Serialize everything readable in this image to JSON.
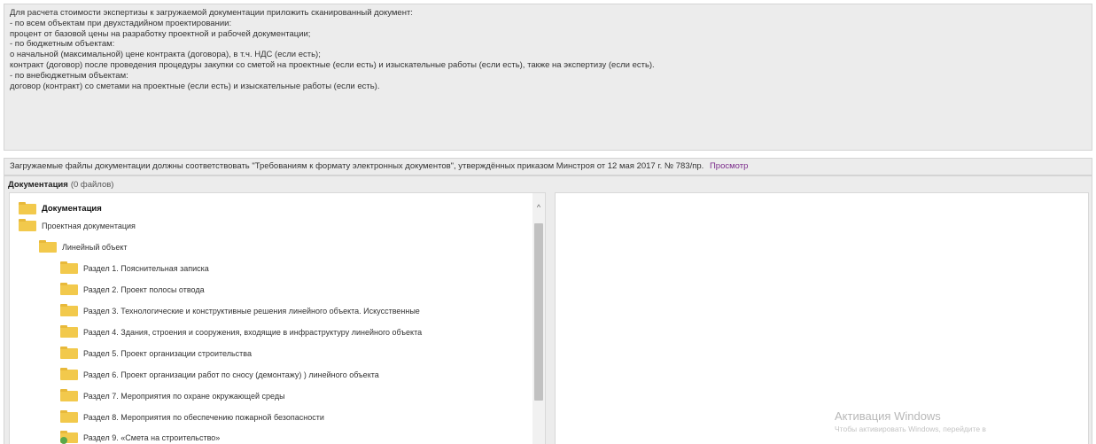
{
  "info": {
    "lines": [
      "Для расчета стоимости экспертизы к загружаемой документации приложить сканированный документ:",
      "- по всем объектам при двухстадийном проектировании:",
      "  процент от базовой цены на разработку проектной и рабочей документации;",
      "- по бюджетным объектам:",
      "  о начальной (максимальной) цене контракта (договора), в т.ч. НДС (если есть);",
      "  контракт (договор) после проведения процедуры закупки со сметой на проектные (если есть) и изыскательные работы (если есть), также на экспертизу (если есть).",
      "- по внебюджетным объектам:",
      "  договор (контракт) со сметами на проектные (если есть) и изыскательные работы (если есть)."
    ]
  },
  "format_notice": {
    "text": "Загружаемые файлы документации должны соответствовать \"Требованиям к формату электронных документов\", утверждённых приказом Минстроя от 12 мая 2017 г. № 783/пр.",
    "link": "Просмотр"
  },
  "documents": {
    "title": "Документация",
    "count": "(0 файлов)",
    "tree": [
      {
        "label": "Документация",
        "level": 0,
        "root": true,
        "badge": false
      },
      {
        "label": "Проектная документация",
        "level": 1,
        "root": false,
        "badge": false
      },
      {
        "label": "Линейный объект",
        "level": 2,
        "root": false,
        "badge": false
      },
      {
        "label": "Раздел 1. Пояснительная записка",
        "level": 3,
        "root": false,
        "badge": false
      },
      {
        "label": "Раздел 2. Проект полосы отвода",
        "level": 3,
        "root": false,
        "badge": false
      },
      {
        "label": "Раздел 3. Технологические и конструктивные решения линейного объекта. Искусственные",
        "level": 3,
        "root": false,
        "badge": false
      },
      {
        "label": "Раздел 4. Здания, строения и сооружения, входящие в инфраструктуру линейного объекта",
        "level": 3,
        "root": false,
        "badge": false
      },
      {
        "label": "Раздел 5. Проект организации строительства",
        "level": 3,
        "root": false,
        "badge": false
      },
      {
        "label": "Раздел 6. Проект организации работ по сносу (демонтажу) ) линейного объекта",
        "level": 3,
        "root": false,
        "badge": false
      },
      {
        "label": "Раздел 7. Мероприятия по охране окружающей среды",
        "level": 3,
        "root": false,
        "badge": false
      },
      {
        "label": "Раздел 8. Мероприятия по обеспечению пожарной безопасности",
        "level": 3,
        "root": false,
        "badge": false
      },
      {
        "label": "Раздел 9. «Смета на строительство»",
        "level": 3,
        "root": false,
        "badge": true
      }
    ]
  },
  "watermark": {
    "title": "Активация Windows",
    "subtitle": "Чтобы активировать Windows, перейдите в"
  },
  "colors": {
    "panel_bg": "#ececec",
    "folder": "#f2c94c",
    "link": "#7a2a8a",
    "badge": "#5aa84a"
  },
  "icons": {
    "folder": "folder-icon",
    "scroll_up": "chevron-up-icon",
    "badge": "plus-badge-icon"
  }
}
